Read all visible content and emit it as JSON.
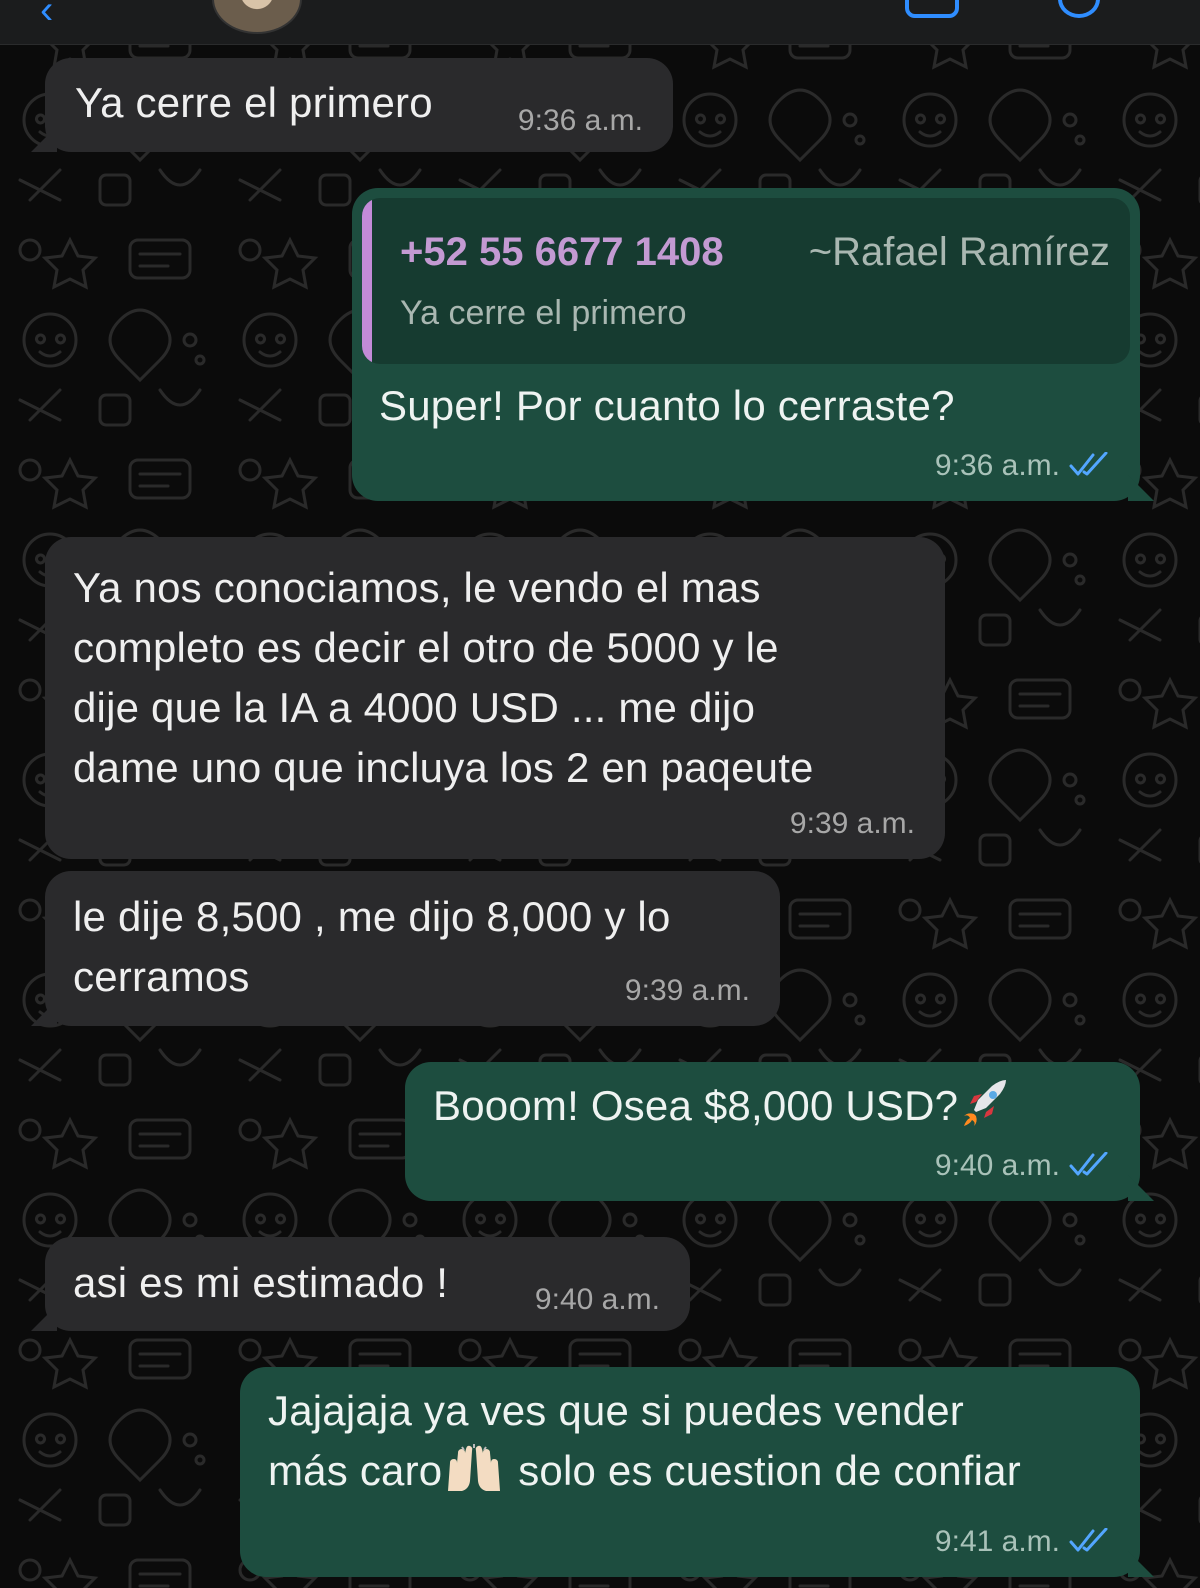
{
  "header": {
    "back_icon": "chevron-left-icon",
    "video_icon": "video-icon",
    "call_icon": "phone-icon"
  },
  "messages": [
    {
      "direction": "in",
      "text": "Ya cerre el primero",
      "time": "9:36 a.m."
    },
    {
      "direction": "out",
      "reply": {
        "phone": "+52 55 6677 1408",
        "name": "~Rafael Ramírez",
        "text": "Ya cerre el primero"
      },
      "text": "Super! Por cuanto lo cerraste?",
      "time": "9:36 a.m.",
      "status": "read"
    },
    {
      "direction": "in",
      "lines": [
        "Ya nos conociamos, le vendo el mas",
        "completo es decir el otro de 5000 y le",
        "dije que la IA a 4000 USD ... me dijo",
        "dame uno que incluya los 2 en paqeute"
      ],
      "time": "9:39 a.m."
    },
    {
      "direction": "in",
      "lines": [
        "le dije 8,500 , me dijo 8,000 y lo",
        "cerramos"
      ],
      "time": "9:39 a.m."
    },
    {
      "direction": "out",
      "text": "Booom! Osea $8,000 USD?",
      "emoji": "rocket-emoji",
      "time": "9:40 a.m.",
      "status": "read"
    },
    {
      "direction": "in",
      "text": "asi es mi estimado !",
      "time": "9:40 a.m."
    },
    {
      "direction": "out",
      "line1": "Jajajaja ya ves que si puedes vender",
      "line2a": "más caro",
      "line2_emoji": "raising-hands-emoji",
      "line2b": " solo es cuestion de confiar",
      "time": "9:41 a.m.",
      "status": "read"
    }
  ],
  "colors": {
    "incoming": "#2a2a2c",
    "outgoing": "#1d4d3f",
    "read_ticks": "#53a6ff",
    "quote_bar": "#c38bd8"
  }
}
